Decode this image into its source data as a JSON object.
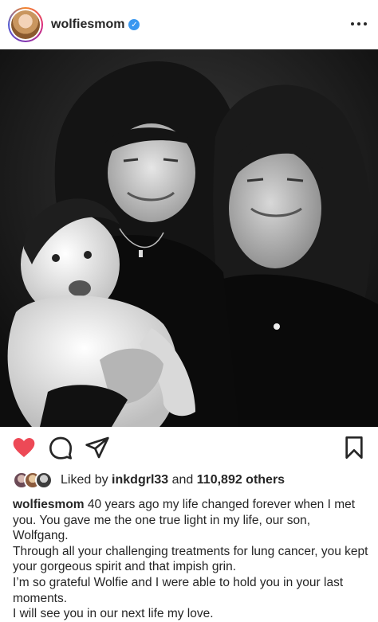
{
  "post": {
    "username": "wolfiesmom",
    "verified": true,
    "more_icon": "more-horizontal-icon"
  },
  "photo": {
    "alt": "Black and white family portrait"
  },
  "actions": {
    "like_icon": "heart-filled-icon",
    "like_color": "#ed4956",
    "comment_icon": "comment-icon",
    "share_icon": "send-icon",
    "save_icon": "bookmark-icon"
  },
  "likes": {
    "prefix": "Liked by ",
    "user": "inkdgrl33",
    "middle": " and ",
    "count": "110,892 others"
  },
  "caption": {
    "username": "wolfiesmom",
    "lines": [
      "40 years ago my life changed forever when I met you. You gave me the one true light in my life, our son, Wolfgang.",
      "Through all your challenging treatments for lung cancer, you kept your gorgeous spirit and that impish grin.",
      "I’m so grateful Wolfie and I were able to hold you in your last moments.",
      "I will see you in our next life my love."
    ]
  }
}
